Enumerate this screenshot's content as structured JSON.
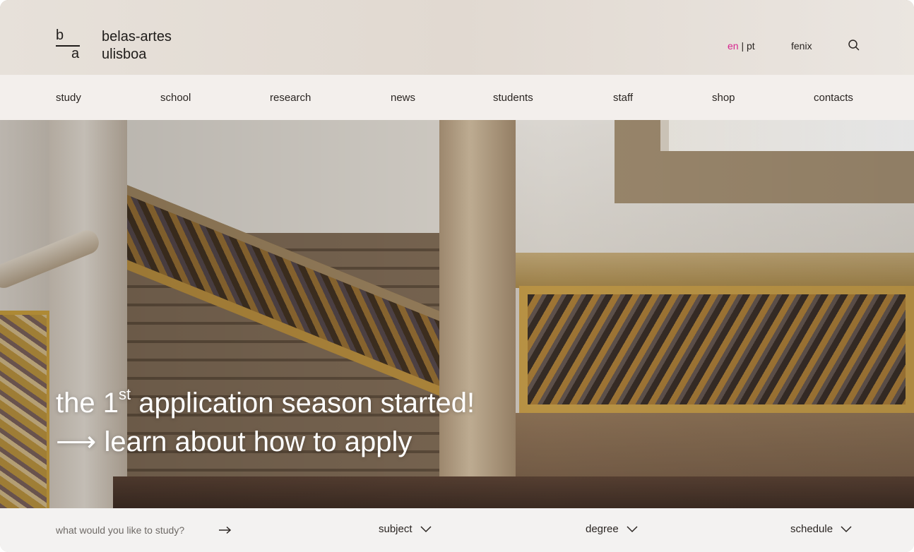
{
  "brand": {
    "mark_top": "b",
    "mark_bottom": "a",
    "name_line1": "belas-artes",
    "name_line2": "ulisboa"
  },
  "utility": {
    "lang_active": "en",
    "lang_sep": "|",
    "lang_other": "pt",
    "fenix": "fenix",
    "search_icon": "search-icon",
    "accent_color": "#d6248e"
  },
  "nav": {
    "items": [
      "study",
      "school",
      "research",
      "news",
      "students",
      "staff",
      "shop",
      "contacts"
    ]
  },
  "hero": {
    "headline_pre": "the 1",
    "headline_sup": "st",
    "headline_post": " application season started!",
    "cta_arrow": "⟶",
    "cta_text": "learn about how to apply"
  },
  "search": {
    "prompt": "what would you like to study?",
    "go_icon": "arrow-right-icon",
    "filters": [
      "subject",
      "degree",
      "schedule"
    ],
    "filter_icon": "chevron-down-icon"
  }
}
